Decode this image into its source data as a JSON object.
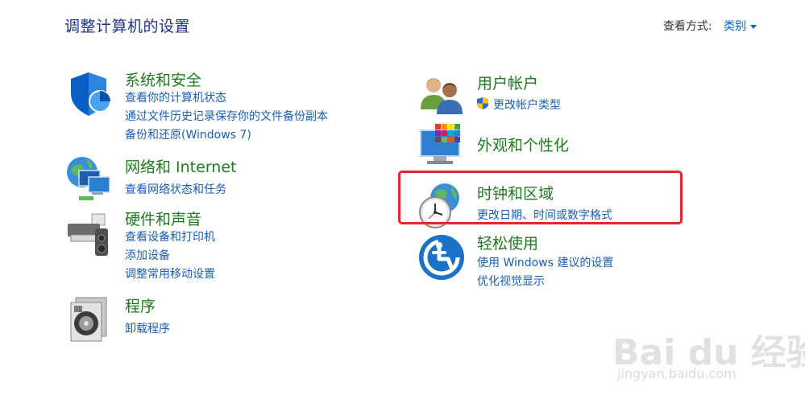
{
  "page_title": "调整计算机的设置",
  "view_by": {
    "label": "查看方式:",
    "value": "类别"
  },
  "categories": [
    {
      "name": "系统和安全",
      "links": [
        "查看你的计算机状态",
        "通过文件历史记录保存你的文件备份副本",
        "备份和还原(Windows 7)"
      ]
    },
    {
      "name": "网络和 Internet",
      "links": [
        "查看网络状态和任务"
      ]
    },
    {
      "name": "硬件和声音",
      "links": [
        "查看设备和打印机",
        "添加设备",
        "调整常用移动设置"
      ]
    },
    {
      "name": "程序",
      "links": [
        "卸载程序"
      ]
    },
    {
      "name": "用户帐户",
      "links": [
        "更改帐户类型"
      ]
    },
    {
      "name": "外观和个性化",
      "links": []
    },
    {
      "name": "时钟和区域",
      "links": [
        "更改日期、时间或数字格式"
      ]
    },
    {
      "name": "轻松使用",
      "links": [
        "使用 Windows 建议的设置",
        "优化视觉显示"
      ]
    }
  ],
  "watermark": {
    "logo": "Bai du 经验",
    "url": "jingyan.baidu.com"
  },
  "colors": {
    "heading": "#1f7a1f",
    "link": "#1a5fb4",
    "title": "#1e3287",
    "highlight": "#e8262a"
  }
}
